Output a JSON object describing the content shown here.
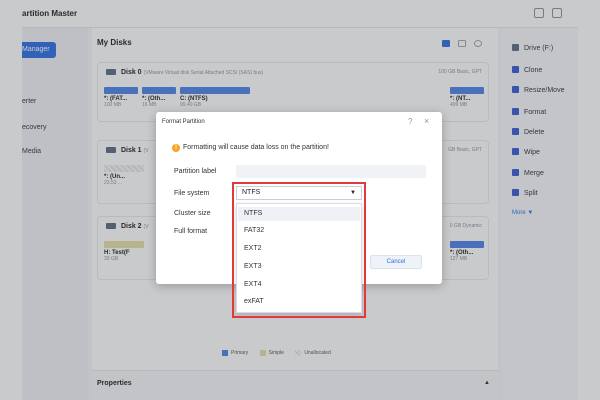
{
  "app": {
    "title": "artition Master"
  },
  "sidebar": {
    "items": [
      {
        "label": "Manager",
        "active": true
      },
      {
        "label": "erter"
      },
      {
        "label": "ecovery"
      },
      {
        "label": "Media"
      }
    ]
  },
  "main": {
    "title": "My Disks",
    "disks": [
      {
        "name": "Disk 0",
        "info": "(VMware  Virtual disk   Serial Attached SCSI (SAS) bus)",
        "meta": "100 GB Basic, GPT",
        "partitions": [
          {
            "name": "*: (FAT...",
            "size": "100 MB"
          },
          {
            "name": "*: (Oth...",
            "size": "16 MB"
          },
          {
            "name": "C: (NTFS)",
            "size": "99.40 GB"
          },
          {
            "name": "*: (NT...",
            "size": "499 MB"
          }
        ]
      },
      {
        "name": "Disk 1",
        "info": "(V",
        "meta": "GB Basic, GPT",
        "partitions": [
          {
            "name": "*: (Un...",
            "size": "23.53 ..."
          }
        ]
      },
      {
        "name": "Disk 2",
        "info": "(V",
        "meta": "0 GB Dynamic",
        "partitions": [
          {
            "name": "H: Test(F",
            "size": "30 GB"
          },
          {
            "name": "*: (Oth...",
            "size": "127 MB"
          }
        ]
      }
    ],
    "legend": {
      "primary": "Primary",
      "simple": "Simple",
      "unallocated": "Unallocated"
    },
    "properties": "Properties"
  },
  "actions": {
    "drive": "Drive (F:)",
    "items": [
      "Clone",
      "Resize/Move",
      "Format",
      "Delete",
      "Wipe",
      "Merge",
      "Split"
    ],
    "more": "More ▼"
  },
  "dialog": {
    "title": "Format Partition",
    "help": "?",
    "close": "×",
    "warning": "Formatting will cause data loss on the partition!",
    "labels": {
      "partition_label": "Partition label",
      "file_system": "File system",
      "cluster_size": "Cluster size",
      "full_format": "Full format"
    },
    "partition_label_value": "",
    "cancel": "Cancel",
    "file_system": {
      "selected": "NTFS",
      "options": [
        "NTFS",
        "FAT32",
        "EXT2",
        "EXT3",
        "EXT4",
        "exFAT"
      ]
    }
  },
  "colors": {
    "accent": "#2f6fe4",
    "highlight": "#e03a3a",
    "warning": "#f5a623"
  },
  "icons": {
    "warning": "warning-icon",
    "dropdown": "caret-down-icon",
    "close": "close-icon",
    "help": "help-icon"
  }
}
